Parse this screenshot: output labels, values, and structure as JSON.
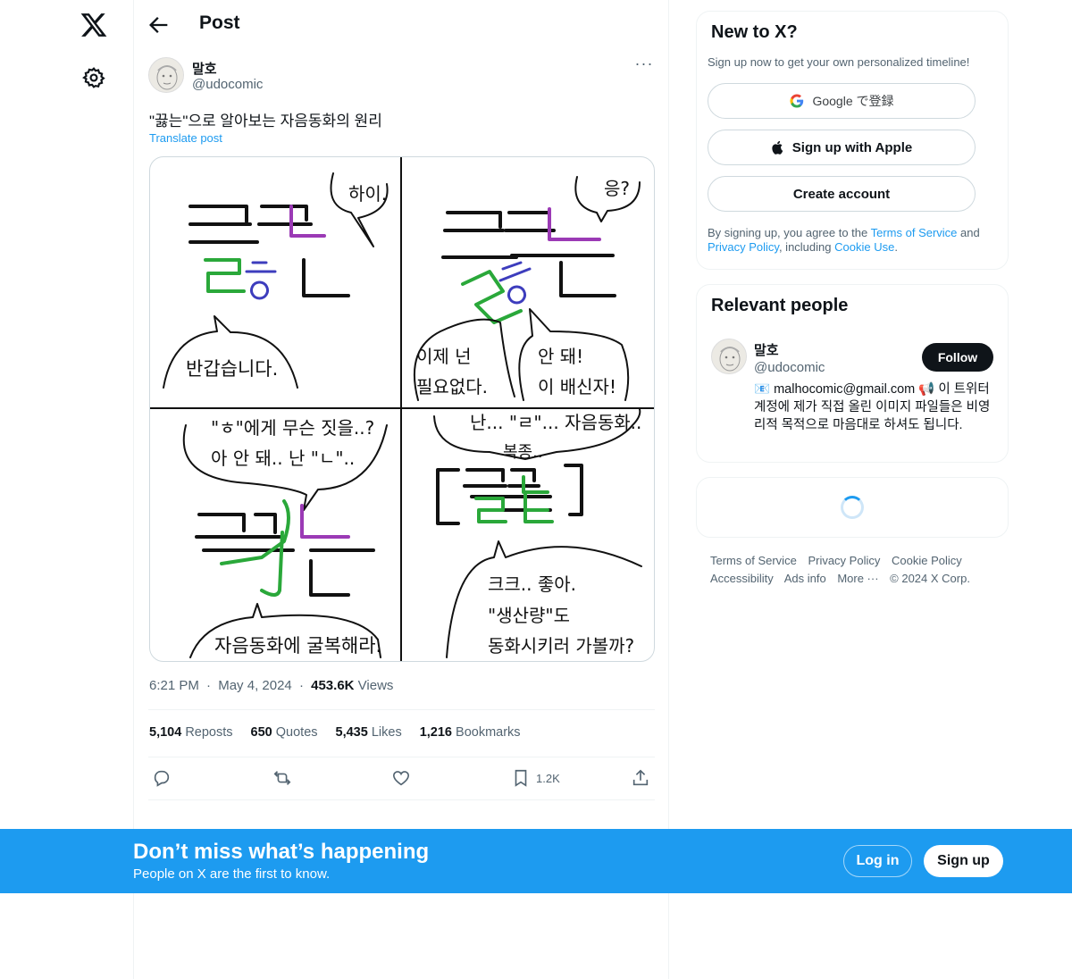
{
  "header": {
    "title": "Post"
  },
  "post": {
    "author_name": "말호",
    "author_handle": "@udocomic",
    "text": "\"끓는\"으로 알아보는 자음동화의 원리",
    "translate": "Translate post",
    "time": "6:21 PM",
    "sep": "·",
    "date": "May 4, 2024",
    "views_count": "453.6K",
    "views_label": "Views",
    "more": "···"
  },
  "comic": {
    "panel1": {
      "bubble": "하이.",
      "speech": "반갑습니다."
    },
    "panel2": {
      "bubble": "응?",
      "left_line1": "이제 넌",
      "left_line2": "필요없다.",
      "right_line1": "안 돼!",
      "right_line2": "이 배신자!"
    },
    "panel3": {
      "line1": "\"ㅎ\"에게 무슨 짓을..?",
      "line2": "아 안 돼.. 난 \"ㄴ\"..",
      "speech": "자음동화에 굴복해라."
    },
    "panel4": {
      "line1": "난... \"ㄹ\"... 자음동화..",
      "line2": "복종..",
      "speech1": "크크.. 좋아.",
      "speech2": "\"생산량\"도",
      "speech3": "동화시키러 가볼까?"
    }
  },
  "stats": {
    "reposts_count": "5,104",
    "reposts_label": "Reposts",
    "quotes_count": "650",
    "quotes_label": "Quotes",
    "likes_count": "5,435",
    "likes_label": "Likes",
    "bookmarks_count": "1,216",
    "bookmarks_label": "Bookmarks"
  },
  "actions": {
    "bookmark_count": "1.2K"
  },
  "signup_card": {
    "title": "New to X?",
    "subtitle": "Sign up now to get your own personalized timeline!",
    "google_label": "Google で登録",
    "apple_label": "Sign up with Apple",
    "create_label": "Create account",
    "legal_pre": "By signing up, you agree to the ",
    "terms_link": "Terms of Service",
    "legal_and": " and ",
    "privacy_link": "Privacy Policy",
    "legal_including": ", including ",
    "cookie_link": "Cookie Use",
    "legal_end": "."
  },
  "relevant": {
    "title": "Relevant people",
    "name": "말호",
    "handle": "@udocomic",
    "follow_label": "Follow",
    "bio": "📧 malhocomic@gmail.com 📢 이 트위터 계정에 제가 직접 올린 이미지 파일들은 비영리적 목적으로 마음대로 하셔도 됩니다."
  },
  "footer": {
    "terms": "Terms of Service",
    "privacy": "Privacy Policy",
    "cookie": "Cookie Policy",
    "accessibility": "Accessibility",
    "ads": "Ads info",
    "more": "More ···",
    "copyright": "© 2024 X Corp."
  },
  "bottom_bar": {
    "title": "Don’t miss what’s happening",
    "subtitle": "People on X are the first to know.",
    "login_label": "Log in",
    "signup_label": "Sign up"
  },
  "colors": {
    "accent": "#1d9bf0",
    "text": "#0f1419",
    "muted": "#536471",
    "bottom_bar": "#1d9bf0"
  },
  "icons": [
    "x-logo-icon",
    "settings-icon",
    "back-arrow-icon",
    "more-icon",
    "reply-icon",
    "repost-icon",
    "like-icon",
    "bookmark-icon",
    "share-icon",
    "google-icon",
    "apple-icon",
    "loading-spinner"
  ]
}
